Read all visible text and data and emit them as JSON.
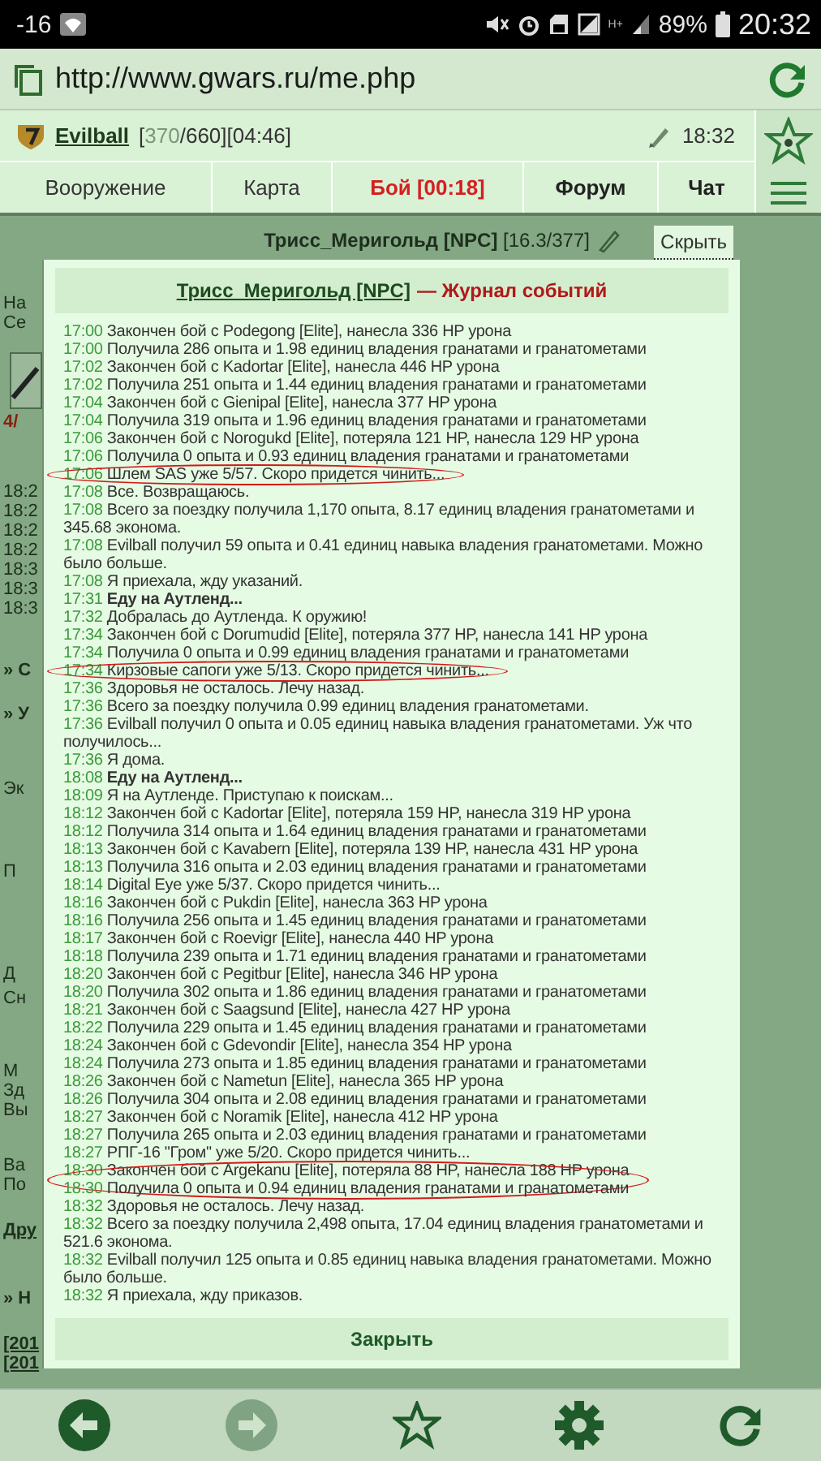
{
  "status_bar": {
    "temperature": "-16",
    "network": "H+",
    "battery": "89%",
    "time": "20:32"
  },
  "browser": {
    "url": "http://www.gwars.ru/me.php"
  },
  "player": {
    "name": "Evilball",
    "stats_prefix": "[",
    "hp": "370",
    "stats_suffix": "/660][04:46]",
    "clock": "18:32"
  },
  "tabs": [
    {
      "label": "Вооружение",
      "kind": "plain"
    },
    {
      "label": "Карта",
      "kind": "plain"
    },
    {
      "label": "Бой [00:18]",
      "kind": "alert"
    },
    {
      "label": "Форум",
      "kind": "bold"
    },
    {
      "label": "Чат",
      "kind": "bold"
    }
  ],
  "npc": {
    "name": "Трисс_Меригольд [NPC]",
    "stats": "[16.3/377]",
    "hide": "Скрыть"
  },
  "page_fragments": [
    {
      "text": "На",
      "kind": "text"
    },
    {
      "text": "Се",
      "kind": "text"
    },
    {
      "text": "4/",
      "kind": "alert"
    },
    {
      "text": "18:2",
      "kind": "time"
    },
    {
      "text": "18:2",
      "kind": "time"
    },
    {
      "text": "18:2",
      "kind": "time"
    },
    {
      "text": "18:2",
      "kind": "time"
    },
    {
      "text": "18:3",
      "kind": "time"
    },
    {
      "text": "18:3",
      "kind": "time"
    },
    {
      "text": "18:3",
      "kind": "time"
    },
    {
      "text": "» С",
      "kind": "section"
    },
    {
      "text": "» У",
      "kind": "section"
    },
    {
      "text": "Эк",
      "kind": "text"
    },
    {
      "text": "П",
      "kind": "text"
    },
    {
      "text": "Д",
      "kind": "text"
    },
    {
      "text": "Сн",
      "kind": "text"
    },
    {
      "text": "М",
      "kind": "text"
    },
    {
      "text": "Зд",
      "kind": "text"
    },
    {
      "text": "Вы",
      "kind": "text"
    },
    {
      "text": "Ва",
      "kind": "text"
    },
    {
      "text": "По",
      "kind": "text"
    },
    {
      "text": "Дру",
      "kind": "link"
    },
    {
      "text": "» Н",
      "kind": "section"
    },
    {
      "text": "[201",
      "kind": "link"
    },
    {
      "text": "[201",
      "kind": "link"
    }
  ],
  "popup": {
    "npc_link": "Трисс_Меригольд [NPC]",
    "title": "— Журнал событий",
    "close": "Закрыть",
    "log": [
      {
        "time": "17:00",
        "text": "Закончен бой с Podegong [Elite], нанесла 336 HP урона",
        "bold": false,
        "circled": false
      },
      {
        "time": "17:00",
        "text": "Получила 286 опыта и 1.98 единиц владения гранатами и гранатометами",
        "bold": false,
        "circled": false
      },
      {
        "time": "17:02",
        "text": "Закончен бой с Kadortar [Elite], нанесла 446 HP урона",
        "bold": false,
        "circled": false
      },
      {
        "time": "17:02",
        "text": "Получила 251 опыта и 1.44 единиц владения гранатами и гранатометами",
        "bold": false,
        "circled": false
      },
      {
        "time": "17:04",
        "text": "Закончен бой с Gienipal [Elite], нанесла 377 HP урона",
        "bold": false,
        "circled": false
      },
      {
        "time": "17:04",
        "text": "Получила 319 опыта и 1.96 единиц владения гранатами и гранатометами",
        "bold": false,
        "circled": false
      },
      {
        "time": "17:06",
        "text": "Закончен бой с Norogukd [Elite], потеряла 121 HP, нанесла 129 HP урона",
        "bold": false,
        "circled": false
      },
      {
        "time": "17:06",
        "text": "Получила 0 опыта и 0.93 единиц владения гранатами и гранатометами",
        "bold": false,
        "circled": false
      },
      {
        "time": "17:06",
        "text": "Шлем SAS уже 5/57. Скоро придется чинить...",
        "bold": false,
        "circled": true
      },
      {
        "time": "17:08",
        "text": "Все. Возвращаюсь.",
        "bold": false,
        "circled": false
      },
      {
        "time": "17:08",
        "text": "Всего за поездку получила 1,170 опыта, 8.17 единиц владения гранатометами и 345.68 эконома.",
        "bold": false,
        "circled": false
      },
      {
        "time": "17:08",
        "text": "Evilball получил 59 опыта и 0.41 единиц навыка владения гранатометами. Можно было больше.",
        "bold": false,
        "circled": false
      },
      {
        "time": "17:08",
        "text": "Я приехала, жду указаний.",
        "bold": false,
        "circled": false
      },
      {
        "time": "17:31",
        "text": "Еду на Аутленд...",
        "bold": true,
        "circled": false
      },
      {
        "time": "17:32",
        "text": "Добралась до Аутленда. К оружию!",
        "bold": false,
        "circled": false
      },
      {
        "time": "17:34",
        "text": "Закончен бой с Dorumudid [Elite], потеряла 377 HP, нанесла 141 HP урона",
        "bold": false,
        "circled": false
      },
      {
        "time": "17:34",
        "text": "Получила 0 опыта и 0.99 единиц владения гранатами и гранатометами",
        "bold": false,
        "circled": false
      },
      {
        "time": "17:34",
        "text": "Кирзовые сапоги уже 5/13. Скоро придется чинить...",
        "bold": false,
        "circled": true
      },
      {
        "time": "17:36",
        "text": "Здоровья не осталось. Лечу назад.",
        "bold": false,
        "circled": false
      },
      {
        "time": "17:36",
        "text": "Всего за поездку получила 0.99 единиц владения гранатометами.",
        "bold": false,
        "circled": false
      },
      {
        "time": "17:36",
        "text": "Evilball получил 0 опыта и 0.05 единиц навыка владения гранатометами. Уж что получилось...",
        "bold": false,
        "circled": false
      },
      {
        "time": "17:36",
        "text": "Я дома.",
        "bold": false,
        "circled": false
      },
      {
        "time": "18:08",
        "text": "Еду на Аутленд...",
        "bold": true,
        "circled": false
      },
      {
        "time": "18:09",
        "text": "Я на Аутленде. Приступаю к поискам...",
        "bold": false,
        "circled": false
      },
      {
        "time": "18:12",
        "text": "Закончен бой с Kadortar [Elite], потеряла 159 HP, нанесла 319 HP урона",
        "bold": false,
        "circled": false
      },
      {
        "time": "18:12",
        "text": "Получила 314 опыта и 1.64 единиц владения гранатами и гранатометами",
        "bold": false,
        "circled": false
      },
      {
        "time": "18:13",
        "text": "Закончен бой с Kavabern [Elite], потеряла 139 HP, нанесла 431 HP урона",
        "bold": false,
        "circled": false
      },
      {
        "time": "18:13",
        "text": "Получила 316 опыта и 2.03 единиц владения гранатами и гранатометами",
        "bold": false,
        "circled": false
      },
      {
        "time": "18:14",
        "text": "Digital Eye уже 5/37. Скоро придется чинить...",
        "bold": false,
        "circled": false
      },
      {
        "time": "18:16",
        "text": "Закончен бой с Pukdin [Elite], нанесла 363 HP урона",
        "bold": false,
        "circled": false
      },
      {
        "time": "18:16",
        "text": "Получила 256 опыта и 1.45 единиц владения гранатами и гранатометами",
        "bold": false,
        "circled": false
      },
      {
        "time": "18:17",
        "text": "Закончен бой с Roevigr [Elite], нанесла 440 HP урона",
        "bold": false,
        "circled": false
      },
      {
        "time": "18:18",
        "text": "Получила 239 опыта и 1.71 единиц владения гранатами и гранатометами",
        "bold": false,
        "circled": false
      },
      {
        "time": "18:20",
        "text": "Закончен бой с Pegitbur [Elite], нанесла 346 HP урона",
        "bold": false,
        "circled": false
      },
      {
        "time": "18:20",
        "text": "Получила 302 опыта и 1.86 единиц владения гранатами и гранатометами",
        "bold": false,
        "circled": false
      },
      {
        "time": "18:21",
        "text": "Закончен бой с Saagsund [Elite], нанесла 427 HP урона",
        "bold": false,
        "circled": false
      },
      {
        "time": "18:22",
        "text": "Получила 229 опыта и 1.45 единиц владения гранатами и гранатометами",
        "bold": false,
        "circled": false
      },
      {
        "time": "18:24",
        "text": "Закончен бой с Gdevondir [Elite], нанесла 354 HP урона",
        "bold": false,
        "circled": false
      },
      {
        "time": "18:24",
        "text": "Получила 273 опыта и 1.85 единиц владения гранатами и гранатометами",
        "bold": false,
        "circled": false
      },
      {
        "time": "18:26",
        "text": "Закончен бой с Nametun [Elite], нанесла 365 HP урона",
        "bold": false,
        "circled": false
      },
      {
        "time": "18:26",
        "text": "Получила 304 опыта и 2.08 единиц владения гранатами и гранатометами",
        "bold": false,
        "circled": false
      },
      {
        "time": "18:27",
        "text": "Закончен бой с Noramik [Elite], нанесла 412 HP урона",
        "bold": false,
        "circled": false
      },
      {
        "time": "18:27",
        "text": "Получила 265 опыта и 2.03 единиц владения гранатами и гранатометами",
        "bold": false,
        "circled": false
      },
      {
        "time": "18:27",
        "text": "РПГ-16 \"Гром\" уже 5/20. Скоро придется чинить...",
        "bold": false,
        "circled": false
      },
      {
        "time": "18:30",
        "text": "Закончен бой с Argekanu [Elite], потеряла 88 HP, нанесла 188 HP урона",
        "bold": false,
        "circled": true
      },
      {
        "time": "18:30",
        "text": "Получила 0 опыта и 0.94 единиц владения гранатами и гранатометами",
        "bold": false,
        "circled": true
      },
      {
        "time": "18:32",
        "text": "Здоровья не осталось. Лечу назад.",
        "bold": false,
        "circled": false
      },
      {
        "time": "18:32",
        "text": "Всего за поездку получила 2,498 опыта, 17.04 единиц владения гранатометами и 521.6 эконома.",
        "bold": false,
        "circled": false
      },
      {
        "time": "18:32",
        "text": "Evilball получил 125 опыта и 0.85 единиц навыка владения гранатометами. Можно было больше.",
        "bold": false,
        "circled": false
      },
      {
        "time": "18:32",
        "text": "Я приехала, жду приказов.",
        "bold": false,
        "circled": false
      }
    ]
  }
}
